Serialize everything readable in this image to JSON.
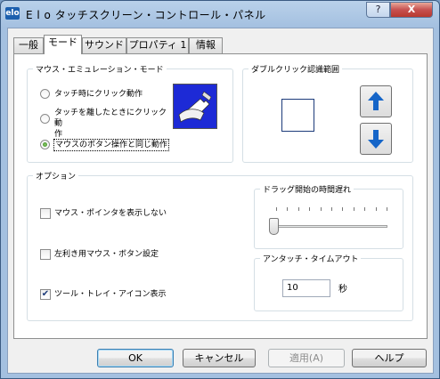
{
  "window": {
    "logo": "elo",
    "title": "E l o タッチスクリーン・コントロール・パネル",
    "help_glyph": "?",
    "close_glyph": "X"
  },
  "tabs": [
    "一般",
    "モード",
    "サウンド",
    "プロパティ 1",
    "情報"
  ],
  "active_tab": "モード",
  "mouse_mode": {
    "title": "マウス・エミュレーション・モード",
    "options": [
      {
        "label": "タッチ時にクリック動作",
        "selected": false
      },
      {
        "label": "タッチを離したときにクリック動\n作",
        "selected": false
      },
      {
        "label": "マウスのボタン操作と同じ動作",
        "selected": true
      }
    ],
    "image_icon": "touch-hand-icon"
  },
  "double_click": {
    "title": "ダブルクリック認識範囲",
    "up_icon": "arrow-up-icon",
    "down_icon": "arrow-down-icon"
  },
  "options_group": {
    "title": "オプション",
    "checkboxes": [
      {
        "label": "マウス・ポインタを表示しない",
        "checked": false
      },
      {
        "label": "左利き用マウス・ボタン設定",
        "checked": false
      },
      {
        "label": "ツール・トレイ・アイコン表示",
        "checked": true
      }
    ]
  },
  "drag_delay": {
    "title": "ドラッグ開始の時間遅れ",
    "level": 0
  },
  "untouch_timeout": {
    "title": "アンタッチ・タイムアウト",
    "value": "10",
    "unit": "秒"
  },
  "buttons": {
    "ok": "OK",
    "cancel": "キャンセル",
    "apply": "適用(A)",
    "help": "ヘルプ"
  },
  "colors": {
    "accent": "#1565c8",
    "title_bar": "#b9d1ea",
    "close": "#c75050"
  }
}
